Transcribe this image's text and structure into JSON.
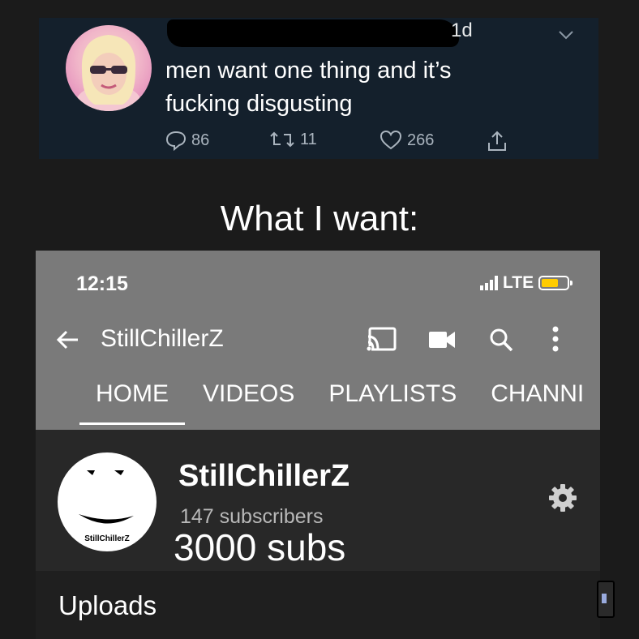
{
  "tweet": {
    "time": "1d",
    "lines": [
      "men want one thing and it’s",
      "fucking disgusting"
    ],
    "replies": "86",
    "retweets": "11",
    "likes": "266",
    "icons": [
      "reply-icon",
      "retweet-icon",
      "heart-icon",
      "share-icon",
      "chevron-down-icon"
    ]
  },
  "caption": "What I want:",
  "youtube": {
    "status": {
      "time": "12:15",
      "network": "LTE",
      "battery_color": "#ffcc00"
    },
    "app_bar": {
      "title": "StillChillerZ",
      "icons": [
        "back-arrow-icon",
        "cast-icon",
        "camera-icon",
        "search-icon",
        "more-vert-icon"
      ]
    },
    "tabs": [
      {
        "label": "HOME",
        "active": true
      },
      {
        "label": "VIDEOS",
        "active": false
      },
      {
        "label": "PLAYLISTS",
        "active": false
      },
      {
        "label": "CHANNI",
        "active": false
      }
    ],
    "channel": {
      "name": "StillChillerZ",
      "subscribers": "147 subscribers",
      "edited_subs": "3000 subs",
      "logo_text": "StillChillerZ"
    },
    "uploads_label": "Uploads"
  }
}
